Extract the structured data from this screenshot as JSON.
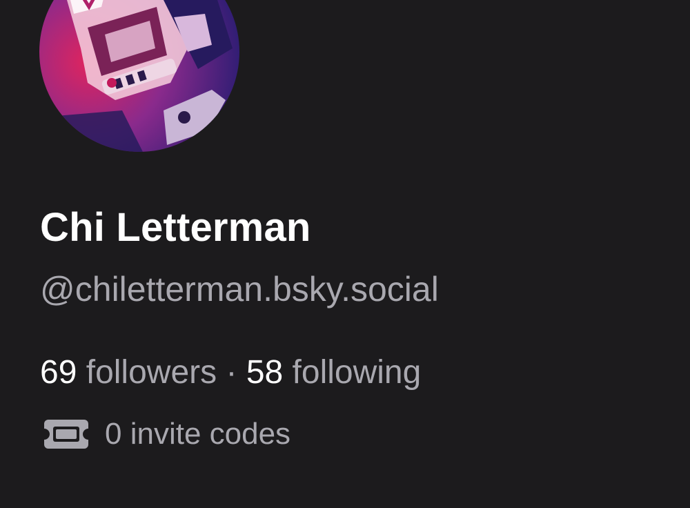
{
  "profile": {
    "display_name": "Chi Letterman",
    "handle": "@chiletterman.bsky.social",
    "followers_count": "69",
    "followers_label": "followers",
    "separator": "·",
    "following_count": "58",
    "following_label": "following",
    "invite_codes_text": "0 invite codes"
  },
  "icons": {
    "avatar": "avatar-image",
    "invite": "ticket-icon"
  },
  "colors": {
    "background": "#1c1b1d",
    "name": "#ffffff",
    "muted": "#a9a8af"
  }
}
